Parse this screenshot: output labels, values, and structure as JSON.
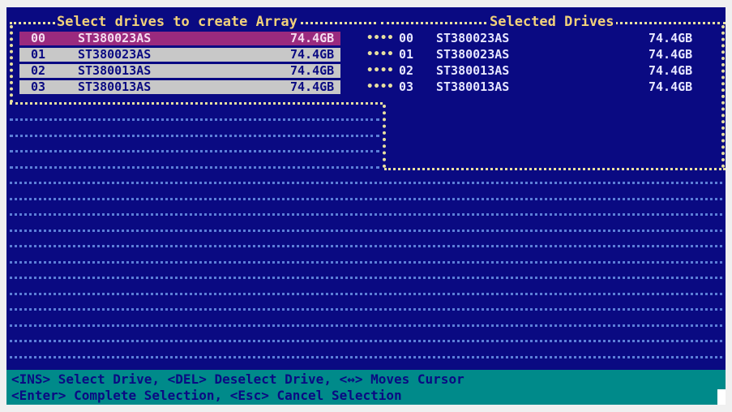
{
  "left_panel": {
    "title": "Select drives to create Array",
    "drives": [
      {
        "id": "00",
        "model": "ST380023AS",
        "size": "74.4GB",
        "selected": true
      },
      {
        "id": "01",
        "model": "ST380023AS",
        "size": "74.4GB",
        "selected": false
      },
      {
        "id": "02",
        "model": "ST380013AS",
        "size": "74.4GB",
        "selected": false
      },
      {
        "id": "03",
        "model": "ST380013AS",
        "size": "74.4GB",
        "selected": false
      }
    ]
  },
  "right_panel": {
    "title": "Selected Drives",
    "drives": [
      {
        "id": "00",
        "model": "ST380023AS",
        "size": "74.4GB"
      },
      {
        "id": "01",
        "model": "ST380023AS",
        "size": "74.4GB"
      },
      {
        "id": "02",
        "model": "ST380013AS",
        "size": "74.4GB"
      },
      {
        "id": "03",
        "model": "ST380013AS",
        "size": "74.4GB"
      }
    ]
  },
  "connector": "••••",
  "footer": {
    "line1": "<INS> Select Drive, <DEL> Deselect Drive, <↔> Moves Cursor",
    "line2": "<Enter> Complete Selection, <Esc> Cancel Selection"
  },
  "colors": {
    "background": "#0a0a82",
    "highlight": "#9a2a7e",
    "row_bg": "#c8c8c8",
    "border": "#e8e0a0",
    "footer_bg": "#008a8a"
  }
}
